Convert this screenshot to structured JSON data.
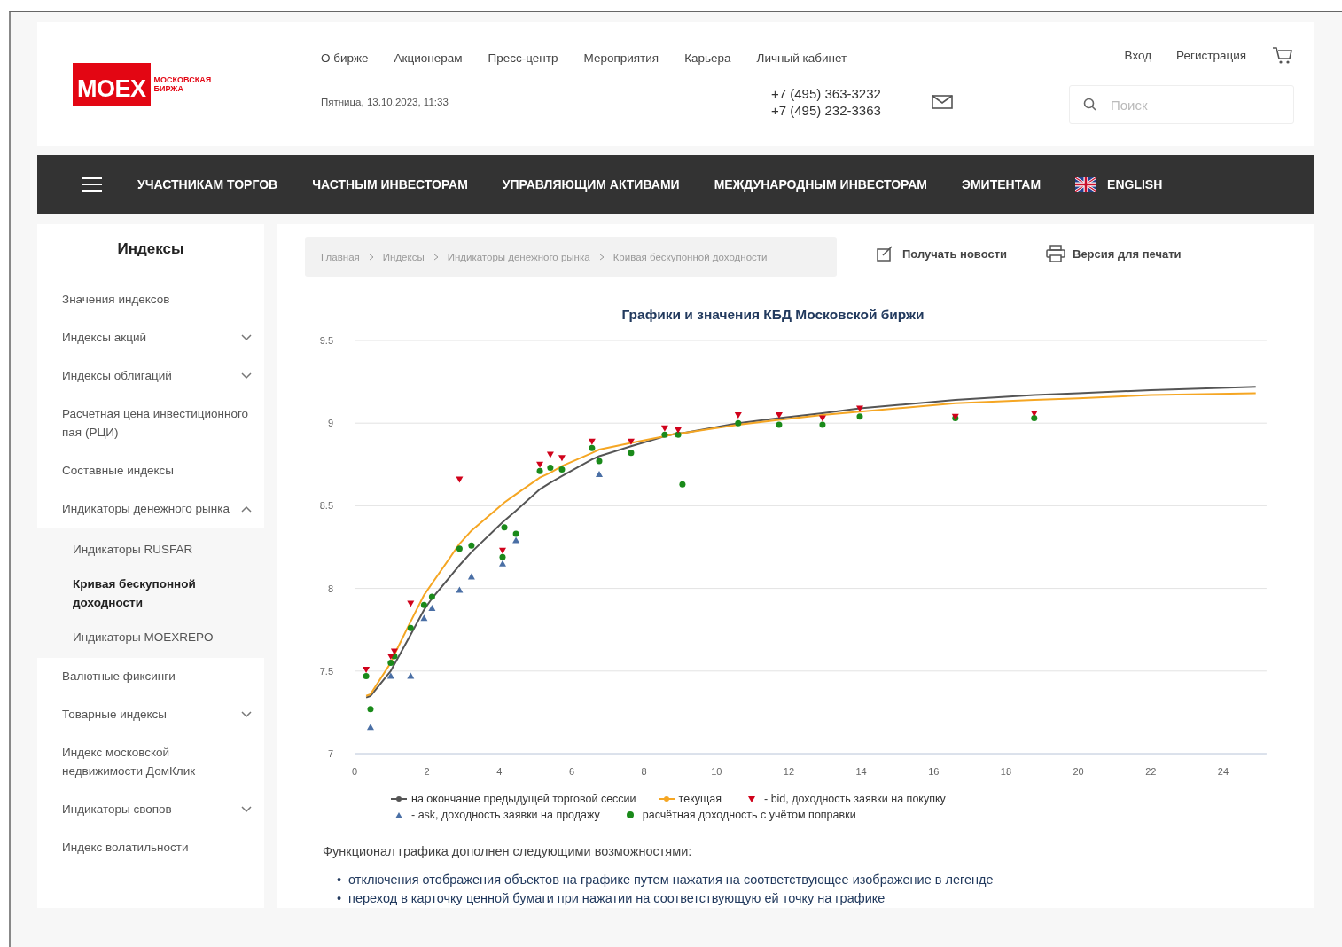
{
  "header": {
    "logo": {
      "mark": "MOEX",
      "name_line_1": "МОСКОВСКАЯ",
      "name_line_2": "БИРЖА"
    },
    "top_links": [
      "О бирже",
      "Акционерам",
      "Пресс-центр",
      "Мероприятия",
      "Карьера",
      "Личный кабинет"
    ],
    "auth_links": [
      "Вход",
      "Регистрация"
    ],
    "date": "Пятница, 13.10.2023, 11:33",
    "phones": [
      "+7 (495) 363-3232",
      "+7 (495) 232-3363"
    ],
    "search": {
      "placeholder": "Поиск"
    }
  },
  "main_nav": {
    "items": [
      "УЧАСТНИКАМ ТОРГОВ",
      "ЧАСТНЫМ ИНВЕСТОРАМ",
      "УПРАВЛЯЮЩИМ АКТИВАМИ",
      "МЕЖДУНАРОДНЫМ ИНВЕСТОРАМ",
      "ЭМИТЕНТАМ"
    ],
    "language": "ENGLISH"
  },
  "sidebar": {
    "title": "Индексы",
    "items": [
      {
        "label": "Значения индексов",
        "selected": false
      },
      {
        "label": "Индексы акций",
        "selected": false,
        "expanded": false
      },
      {
        "label": "Индексы облигаций",
        "selected": false,
        "expanded": false
      },
      {
        "label": "Расчетная цена инвестиционного пая (РЦИ)",
        "selected": false
      },
      {
        "label": "Составные индексы",
        "selected": false
      },
      {
        "label": "Индикаторы денежного рынка",
        "selected": false,
        "expanded": true,
        "children": [
          {
            "label": "Индикаторы RUSFAR",
            "selected": false
          },
          {
            "label": "Кривая бескупонной доходности",
            "selected": true
          },
          {
            "label": "Индикаторы MOEXREPO",
            "selected": false
          }
        ]
      },
      {
        "label": "Валютные фиксинги",
        "selected": false
      },
      {
        "label": "Товарные индексы",
        "selected": false,
        "expanded": false
      },
      {
        "label": "Индекс московской недвижимости ДомКлик",
        "selected": false
      },
      {
        "label": "Индикаторы свопов",
        "selected": false,
        "expanded": false
      },
      {
        "label": "Индекс волатильности",
        "selected": false
      }
    ]
  },
  "breadcrumb": [
    "Главная",
    "Индексы",
    "Индикаторы денежного рынка",
    "Кривая бескупонной доходности"
  ],
  "actions": [
    "Получать новости",
    "Версия для печати"
  ],
  "chart_data": {
    "type": "scatter",
    "title": "Графики и значения КБД Московской биржи",
    "xlim": [
      0,
      25.2
    ],
    "grid": true,
    "legend": "bottom",
    "ylim": [
      7,
      9.5
    ],
    "xticks": [
      0,
      2,
      4,
      6,
      8,
      10,
      12,
      14,
      16,
      18,
      20,
      22,
      24
    ],
    "yticks": [
      7,
      7.5,
      8,
      8.5,
      9,
      9.5
    ],
    "x": [
      0.32,
      0.44,
      1.0,
      1.1,
      1.55,
      1.92,
      2.14,
      2.9,
      3.23,
      4.09,
      4.14,
      4.46,
      5.12,
      5.41,
      5.73,
      6.56,
      6.76,
      7.64,
      8.57,
      8.94,
      9.06,
      10.6,
      11.73,
      12.93,
      13.96,
      16.6,
      18.78,
      20,
      22,
      24.9
    ],
    "series": [
      {
        "name": "на окончание предыдущей торговой сессии",
        "color": "#555555",
        "type": "line",
        "values": [
          7.34,
          7.35,
          7.5,
          7.54,
          7.72,
          7.87,
          7.94,
          8.14,
          8.22,
          8.4,
          8.41,
          8.47,
          8.6,
          8.64,
          8.68,
          8.78,
          8.8,
          8.86,
          8.92,
          8.94,
          8.94,
          9.0,
          9.03,
          9.06,
          9.09,
          9.14,
          9.17,
          9.18,
          9.2,
          9.22
        ]
      },
      {
        "name": "текущая",
        "color": "#f5a623",
        "type": "line",
        "values": [
          7.35,
          7.36,
          7.55,
          7.6,
          7.8,
          7.96,
          8.03,
          8.27,
          8.35,
          8.51,
          8.52,
          8.57,
          8.67,
          8.7,
          8.74,
          8.82,
          8.84,
          8.88,
          8.92,
          8.94,
          8.94,
          8.99,
          9.02,
          9.05,
          9.07,
          9.12,
          9.14,
          9.15,
          9.17,
          9.18
        ]
      },
      {
        "name": "- bid, доходность заявки на покупку",
        "color": "#d0021b",
        "marker": "triangle",
        "values": [
          7.51,
          null,
          7.59,
          7.62,
          7.91,
          null,
          null,
          8.66,
          null,
          8.23,
          null,
          null,
          8.75,
          8.81,
          8.79,
          8.89,
          null,
          8.89,
          8.97,
          8.96,
          null,
          9.05,
          9.05,
          9.03,
          9.09,
          9.04,
          9.06,
          null,
          null,
          null
        ]
      },
      {
        "name": "- ask, доходность заявки на продажу",
        "color": "#4a6fa5",
        "marker": "triangle",
        "values": [
          null,
          7.16,
          7.47,
          null,
          7.47,
          7.82,
          7.88,
          7.99,
          8.07,
          8.15,
          null,
          8.29,
          null,
          null,
          null,
          null,
          8.69,
          null,
          null,
          null,
          null,
          null,
          null,
          null,
          null,
          null,
          null,
          null,
          null,
          null
        ]
      },
      {
        "name": "расчётная доходность с учётом поправки",
        "color": "#1a8a1a",
        "marker": "circle",
        "values": [
          7.47,
          7.27,
          7.55,
          7.59,
          7.76,
          7.9,
          7.95,
          8.24,
          8.26,
          8.19,
          8.37,
          8.33,
          8.71,
          8.73,
          8.72,
          8.85,
          8.77,
          8.82,
          8.93,
          8.93,
          8.63,
          9.0,
          8.99,
          8.99,
          9.04,
          9.03,
          9.03,
          null,
          null,
          null
        ]
      }
    ]
  },
  "features": {
    "intro": "Функционал графика дополнен следующими возможностями:",
    "bullet": "•",
    "items": [
      "отключения отображения объектов на графике путем нажатия на соответствующее изображение в легенде",
      "переход в карточку ценной бумаги при нажатии на соответствующую ей точку на графике"
    ]
  }
}
